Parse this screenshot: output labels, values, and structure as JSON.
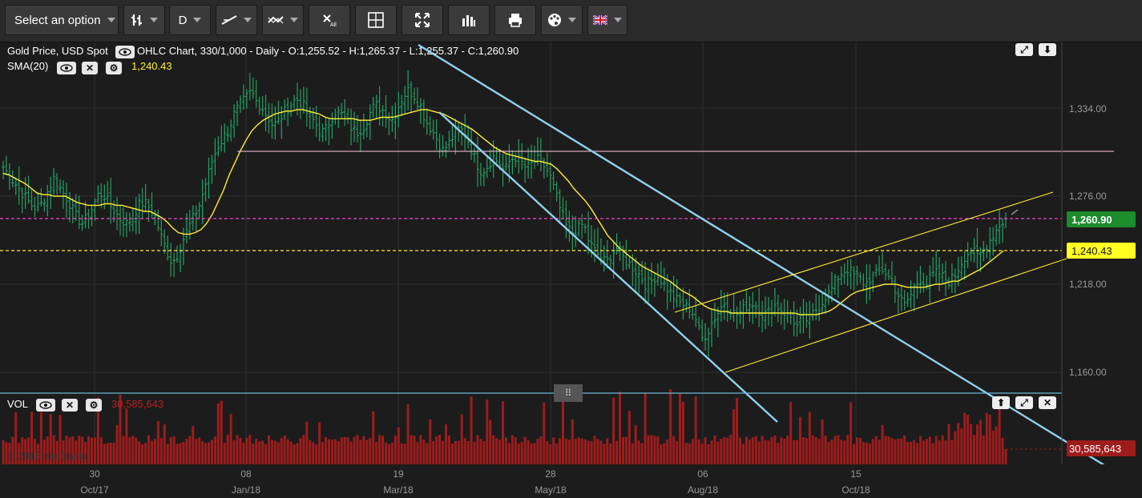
{
  "toolbar": {
    "select_label": "Select an option",
    "interval_label": "D"
  },
  "header": {
    "instrument": "Gold Price, USD Spot",
    "chart_info": "OHLC Chart, 330/1,000 - Daily - O:1,255.52 - H:1,265.37 - L:1,255.37 - C:1,260.90",
    "sma_label": "SMA(20)",
    "sma_value": "1,240.43",
    "vol_label": "VOL",
    "vol_value": "30,585,643",
    "copyright": "© 2018 NetDania"
  },
  "colors": {
    "up_bar": "#1fa56a",
    "down_bar": "#2b9b60",
    "sma": "#ffee33",
    "price_tag": "#1c8c2c",
    "sma_tag": "#ffff22",
    "volume": "#9e1c1c",
    "channel_blue": "#8fd1ec",
    "channel_yellow": "#ffee33",
    "pink_line": "#ff66cc"
  },
  "chart_data": {
    "type": "ohlc",
    "instrument": "Gold Price, USD Spot",
    "price_axis": {
      "ticks": [
        1160,
        1218,
        1276,
        1334
      ],
      "tick_labels": [
        "1,160.00",
        "1,218.00",
        "1,276.00",
        "1,334.00"
      ]
    },
    "x_axis": {
      "day_labels": [
        "30",
        "08",
        "19",
        "28",
        "06",
        "15"
      ],
      "month_labels": [
        "Oct/17",
        "Jan/18",
        "Mar/18",
        "May/18",
        "Aug/18",
        "Oct/18"
      ]
    },
    "last_price": {
      "label": "1,260.90",
      "value": 1260.9
    },
    "sma_last": {
      "label": "1,240.43",
      "value": 1240.43
    },
    "volume_last": {
      "label": "30,585,643"
    },
    "ohlc_last": {
      "open": 1255.52,
      "high": 1265.37,
      "low": 1255.37,
      "close": 1260.9
    },
    "close_series": [
      1295,
      1290,
      1285,
      1280,
      1275,
      1270,
      1268,
      1272,
      1280,
      1288,
      1282,
      1276,
      1270,
      1262,
      1258,
      1262,
      1270,
      1278,
      1276,
      1270,
      1265,
      1260,
      1258,
      1262,
      1270,
      1272,
      1268,
      1262,
      1250,
      1240,
      1232,
      1238,
      1248,
      1256,
      1264,
      1272,
      1285,
      1298,
      1308,
      1314,
      1320,
      1330,
      1336,
      1340,
      1345,
      1338,
      1334,
      1328,
      1322,
      1326,
      1332,
      1336,
      1340,
      1338,
      1330,
      1326,
      1320,
      1318,
      1326,
      1332,
      1330,
      1326,
      1320,
      1318,
      1322,
      1330,
      1336,
      1334,
      1330,
      1326,
      1334,
      1342,
      1346,
      1342,
      1336,
      1326,
      1320,
      1314,
      1306,
      1310,
      1316,
      1320,
      1318,
      1308,
      1298,
      1292,
      1296,
      1302,
      1298,
      1292,
      1300,
      1302,
      1298,
      1294,
      1298,
      1300,
      1296,
      1290,
      1278,
      1266,
      1256,
      1252,
      1254,
      1258,
      1246,
      1240,
      1236,
      1232,
      1238,
      1242,
      1236,
      1232,
      1228,
      1224,
      1218,
      1220,
      1224,
      1220,
      1214,
      1210,
      1206,
      1204,
      1202,
      1195,
      1182,
      1186,
      1194,
      1200,
      1206,
      1202,
      1198,
      1200,
      1204,
      1206,
      1202,
      1198,
      1200,
      1204,
      1202,
      1198,
      1196,
      1190,
      1196,
      1194,
      1200,
      1204,
      1210,
      1214,
      1222,
      1226,
      1228,
      1224,
      1222,
      1218,
      1222,
      1224,
      1228,
      1224,
      1218,
      1210,
      1204,
      1210,
      1218,
      1222,
      1218,
      1224,
      1226,
      1222,
      1220,
      1224,
      1232,
      1238,
      1240,
      1236,
      1240,
      1246,
      1252,
      1258,
      1261
    ],
    "sma_series": [
      1291,
      1290,
      1288,
      1286,
      1284,
      1281,
      1278,
      1277,
      1277,
      1276,
      1276,
      1276,
      1274,
      1272,
      1271,
      1270,
      1270,
      1270,
      1271,
      1271,
      1270,
      1270,
      1269,
      1268,
      1267,
      1266,
      1266,
      1264,
      1262,
      1259,
      1255,
      1252,
      1251,
      1251,
      1252,
      1254,
      1258,
      1264,
      1272,
      1280,
      1290,
      1298,
      1306,
      1313,
      1319,
      1323,
      1326,
      1328,
      1330,
      1331,
      1332,
      1332,
      1333,
      1333,
      1332,
      1331,
      1330,
      1328,
      1327,
      1327,
      1327,
      1327,
      1327,
      1326,
      1326,
      1326,
      1327,
      1328,
      1328,
      1328,
      1329,
      1330,
      1331,
      1332,
      1333,
      1333,
      1332,
      1331,
      1330,
      1328,
      1326,
      1324,
      1322,
      1320,
      1317,
      1314,
      1311,
      1308,
      1306,
      1304,
      1303,
      1302,
      1301,
      1300,
      1299,
      1299,
      1298,
      1297,
      1294,
      1290,
      1286,
      1281,
      1277,
      1273,
      1268,
      1262,
      1256,
      1250,
      1246,
      1242,
      1239,
      1236,
      1233,
      1230,
      1228,
      1226,
      1224,
      1222,
      1220,
      1217,
      1214,
      1212,
      1210,
      1207,
      1204,
      1202,
      1201,
      1200,
      1200,
      1199,
      1199,
      1199,
      1199,
      1199,
      1199,
      1199,
      1199,
      1199,
      1199,
      1199,
      1199,
      1198,
      1198,
      1198,
      1198,
      1199,
      1200,
      1202,
      1205,
      1208,
      1211,
      1213,
      1214,
      1215,
      1216,
      1217,
      1218,
      1218,
      1218,
      1217,
      1216,
      1216,
      1216,
      1216,
      1217,
      1218,
      1218,
      1219,
      1220,
      1220,
      1222,
      1224,
      1226,
      1228,
      1231,
      1234,
      1237,
      1240
    ]
  }
}
